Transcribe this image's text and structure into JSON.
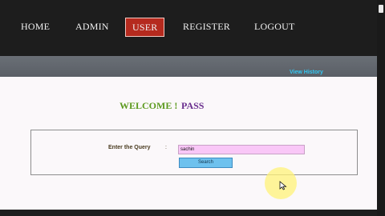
{
  "nav": {
    "items": [
      {
        "label": "HOME"
      },
      {
        "label": "ADMIN"
      },
      {
        "label": "USER",
        "active": true
      },
      {
        "label": "REGISTER"
      },
      {
        "label": "LOGOUT"
      }
    ]
  },
  "subbar": {
    "link_label": "View History"
  },
  "welcome": {
    "greeting": "WELCOME !",
    "username": "PASS"
  },
  "query": {
    "label": "Enter the Query",
    "separator": ":",
    "input_value": "sachin",
    "button_label": "Search"
  },
  "colors": {
    "nav_bg": "#1d1d1d",
    "active_tab": "#b52a1e",
    "welcome_text": "#5c9a1f",
    "username_text": "#6a2f8e",
    "link": "#33c7f2",
    "input_bg": "#f9c7f7",
    "button_bg": "#6ec1ee"
  },
  "icons": {
    "cursor": "mouse-pointer-icon"
  }
}
